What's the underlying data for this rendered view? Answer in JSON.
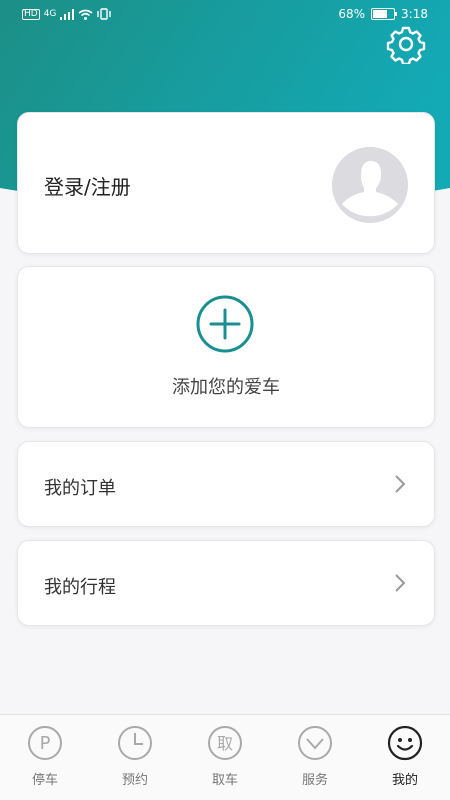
{
  "status_bar": {
    "network": "HD",
    "signal": "4G",
    "battery_percent": "68%",
    "battery_level": 0.68,
    "time": "3:18"
  },
  "header": {
    "settings_icon": "gear-icon"
  },
  "login_card": {
    "label": "登录/注册",
    "avatar_icon": "default-avatar-icon"
  },
  "add_car": {
    "label": "添加您的爱车",
    "icon": "plus-circle-icon"
  },
  "menu": {
    "orders_label": "我的订单",
    "trips_label": "我的行程"
  },
  "tabbar": {
    "tabs": [
      {
        "label": "停车",
        "icon": "parking-icon",
        "glyph": "P"
      },
      {
        "label": "预约",
        "icon": "clock-icon"
      },
      {
        "label": "取车",
        "icon": "pickup-icon",
        "glyph": "取"
      },
      {
        "label": "服务",
        "icon": "chevron-down-circle-icon"
      },
      {
        "label": "我的",
        "icon": "smiley-icon"
      }
    ],
    "active_index": 4
  },
  "colors": {
    "accent": "#1a9aa0",
    "hero_start": "#1c8f86",
    "hero_end": "#13a9b5",
    "tab_inactive": "#a9a9a9",
    "tab_active": "#222222"
  }
}
